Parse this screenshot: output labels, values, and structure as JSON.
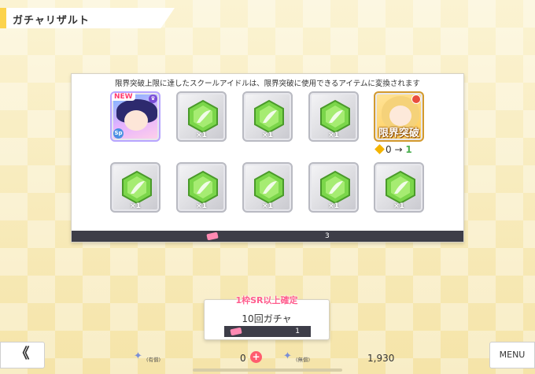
{
  "header": {
    "title": "ガチャリザルト"
  },
  "results": {
    "notice": "限界突破上限に達したスクールアイドルは、限界突破に使用できるアイテムに変換されます",
    "row1": [
      {
        "type": "idol",
        "new": "NEW",
        "badge": "Sp"
      },
      {
        "type": "gem",
        "qty": "×1"
      },
      {
        "type": "gem",
        "qty": "×1"
      },
      {
        "type": "gem",
        "qty": "×1"
      },
      {
        "type": "limit-break",
        "label": "限界突破",
        "from": "0",
        "arrow": "→",
        "to": "1"
      }
    ],
    "row2": [
      {
        "type": "gem",
        "qty": "×1"
      },
      {
        "type": "gem",
        "qty": "×1"
      },
      {
        "type": "gem",
        "qty": "×1"
      },
      {
        "type": "gem",
        "qty": "×1"
      },
      {
        "type": "gem",
        "qty": "×1"
      }
    ],
    "ticket_count": "3"
  },
  "gacha": {
    "guarantee": "1枠SR以上確定",
    "title": "10回ガチャ",
    "cost": "1"
  },
  "footer": {
    "back_label": "《",
    "menu_label": "MENU",
    "paid_label": "(有償)",
    "paid_count": "0",
    "plus": "+",
    "free_label": "(無償)",
    "free_count": "1,930"
  },
  "colors": {
    "gem_green": "#7bd64a",
    "ticket_pink": "#ff8ab3",
    "accent_red": "#ff5c6e",
    "panel_dark": "#3d3d48"
  }
}
